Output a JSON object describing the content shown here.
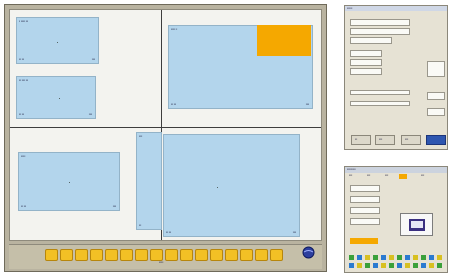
{
  "main_window": {
    "panels": [
      {
        "title": "▪ ▪▪▪▪ ▪▪",
        "footer_left": "▪▪ ▪▪",
        "footer_right": "▪▪▪"
      },
      {
        "title": "▪▪ ▪▪▪ ▪▪",
        "footer_left": "▪▪ ▪▪",
        "footer_right": "▪▪▪"
      },
      {
        "title": "▪▪▪▪ ▪",
        "footer_left": "▪▪ ▪▪",
        "footer_right": "▪▪▪"
      },
      {
        "title": "▪▪▪▪",
        "footer_left": "▪▪ ▪▪",
        "footer_right": "▪▪▪"
      },
      {
        "title": "▪▪▪",
        "footer_left": "▪▪",
        "footer_right": ""
      },
      {
        "title": "",
        "footer_left": "▪▪ ▪▪",
        "footer_right": "▪▪▪"
      }
    ],
    "footer_label": "▪▪▪▪",
    "footer_button_count": 16
  },
  "dialog_small_1": {
    "title": "▪▪▪▪▪",
    "button_labels": [
      "▪▪",
      "▪▪▪",
      "▪▪▪"
    ]
  },
  "dialog_small_2": {
    "title": "▪▪▪▪▪▪▪▪",
    "menu_items": [
      "▪▪▪",
      "▪▪▪",
      "▪▪▪",
      "▪▪▪",
      "▪▪▪"
    ]
  },
  "colors": {
    "panel_fill": "#b3d5ec",
    "highlight": "#f5a800",
    "button_yellow": "#f2c025",
    "frame": "#b9b3a0"
  }
}
